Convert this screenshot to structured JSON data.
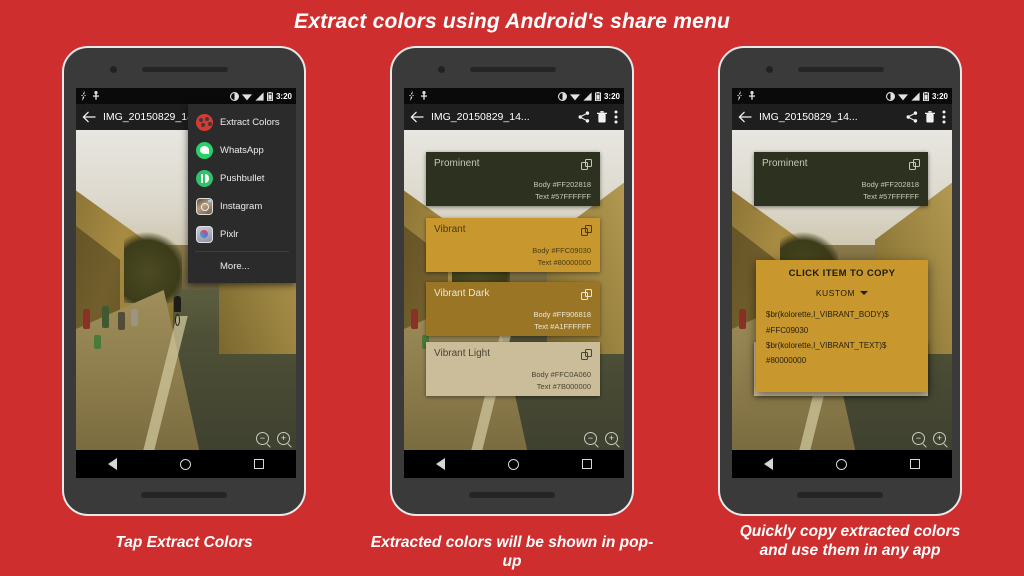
{
  "headline": "Extract colors using Android's share menu",
  "colors": {
    "background_red": "#CF2E2E",
    "phone_body": "#3A3A3A",
    "prominent_body": "#2C3120",
    "vibrant_body": "#C8972E",
    "vibrant_dark_body": "#9A7526",
    "vibrant_light_body": "#CBBD9A"
  },
  "statusbar": {
    "time": "3:20",
    "icons": [
      "flash-off-icon",
      "usb-icon",
      "do-not-disturb-icon",
      "wifi-icon",
      "signal-icon",
      "battery-icon"
    ]
  },
  "toolbar": {
    "title": "IMG_20150829_14...",
    "back_icon": "back-arrow-icon",
    "share_icon": "share-icon",
    "delete_icon": "trash-icon",
    "overflow_icon": "overflow-menu-icon"
  },
  "navbar": {
    "back": "back-triangle-icon",
    "home": "home-circle-icon",
    "recents": "recents-square-icon"
  },
  "zoom_controls": {
    "out": "zoom-out-icon",
    "in": "zoom-in-icon"
  },
  "share_menu": {
    "items": [
      {
        "label": "Extract Colors",
        "icon": "palette-icon"
      },
      {
        "label": "WhatsApp",
        "icon": "whatsapp-icon"
      },
      {
        "label": "Pushbullet",
        "icon": "pushbullet-icon"
      },
      {
        "label": "Instagram",
        "icon": "instagram-icon"
      },
      {
        "label": "Pixlr",
        "icon": "pixlr-icon"
      },
      {
        "label": "More...",
        "icon": "none"
      }
    ]
  },
  "color_cards": [
    {
      "name": "Prominent",
      "body_label": "Body #FF202818",
      "text_label": "Text #57FFFFFF",
      "bg": "#2C3120",
      "fg": "#C6C9B8",
      "copy_icon": "copy-icon"
    },
    {
      "name": "Vibrant",
      "body_label": "Body #FFC09030",
      "text_label": "Text #80000000",
      "bg": "#C8972E",
      "fg": "#4A3C10",
      "copy_icon": "copy-icon"
    },
    {
      "name": "Vibrant Dark",
      "body_label": "Body #FF906818",
      "text_label": "Text #A1FFFFFF",
      "bg": "#9A7526",
      "fg": "#EDE6D6",
      "copy_icon": "copy-icon"
    },
    {
      "name": "Vibrant Light",
      "body_label": "Body #FFC0A060",
      "text_label": "Text #7B000000",
      "bg": "#CBBD9A",
      "fg": "#4A4432",
      "copy_icon": "copy-icon"
    }
  ],
  "popup": {
    "title": "CLICK ITEM TO COPY",
    "preset": "KUSTOM",
    "caret_icon": "chevron-down-icon",
    "items": [
      "$br(kolorette,I_VIBRANT_BODY)$",
      "#FFC09030",
      "$br(kolorette,I_VIBRANT_TEXT)$",
      "#80000000"
    ]
  },
  "captions": {
    "one": "Tap Extract Colors",
    "two": "Extracted colors will be shown in pop-up",
    "three_line1": "Quickly copy extracted colors",
    "three_line2": "and use them in any app"
  }
}
